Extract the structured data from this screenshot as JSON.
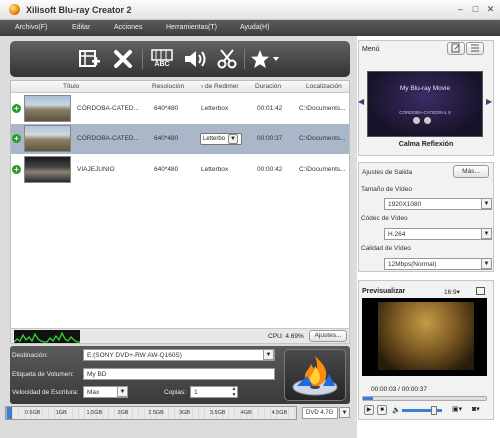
{
  "window": {
    "title": "Xilisoft Blu-ray Creator 2",
    "minimize": "–",
    "maximize": "□",
    "close": "✕"
  },
  "menu": [
    "Archivo(F)",
    "Editar",
    "Acciones",
    "Herramientas(T)",
    "Ayuda(H)"
  ],
  "toolbar": {
    "icons": [
      "add-file-icon",
      "delete-icon",
      "subtitle-icon",
      "audio-icon",
      "clip-icon",
      "effects-icon"
    ],
    "subtitle_text": "ABC"
  },
  "table": {
    "headers": [
      "Título",
      "Resolución",
      "› de Redimer",
      "Duración",
      "Localización"
    ],
    "rows": [
      {
        "title": "CÓRDOBA-CATED...",
        "resolution": "640*480",
        "resize": "Letterbox",
        "duration": "00:01:42",
        "location": "C:\\Documents..."
      },
      {
        "title": "CÓRDOBA-CATED...",
        "resolution": "640*480",
        "resize": "Letterbo",
        "duration": "00:00:37",
        "location": "C:\\Documents..."
      },
      {
        "title": "VIAJEJUNIO",
        "resolution": "640*480",
        "resize": "Letterbox",
        "duration": "00:00:42",
        "location": "C:\\Documents..."
      }
    ]
  },
  "status": {
    "cpu": "CPU: 4.69%",
    "settings_button": "Ajustes..."
  },
  "output": {
    "destination_label": "Destinación:",
    "destination_value": "E:(SONY DVD+-RW AW-Q160S)",
    "volume_label": "Etiqueta de Volumen:",
    "volume_value": "My BD",
    "speed_label": "Velocidad de Escritura:",
    "speed_value": "Max",
    "copies_label": "Copias:",
    "copies_value": "1"
  },
  "capacity": {
    "ticks": [
      "0.5GB",
      "1GB",
      "1.5GB",
      "2GB",
      "2.5GB",
      "3GB",
      "3.5GB",
      "4GB",
      "4.5GB"
    ],
    "disc": "DVD 4.7G",
    "used_fraction": 0.02
  },
  "menu_panel": {
    "title": "Menú",
    "preview_title": "My Blu-ray Movie",
    "preview_item": "CÓRDOBA-CATEDRAL 8",
    "caption": "Calma Reflexión"
  },
  "output_settings": {
    "title": "Ajustes de Salida",
    "more_button": "Más...",
    "video_size_label": "Tamaño de Vídeo",
    "video_size_value": "1920X1080",
    "codec_label": "Códec de Vídeo",
    "codec_value": "H.264",
    "quality_label": "Calidad de Vídeo",
    "quality_value": "12Mbps(Normal)"
  },
  "preview": {
    "title": "Previsualizar",
    "ratio": "16:9▾",
    "time": "00:00:03 / 00:00:37",
    "progress_fraction": 0.08
  }
}
